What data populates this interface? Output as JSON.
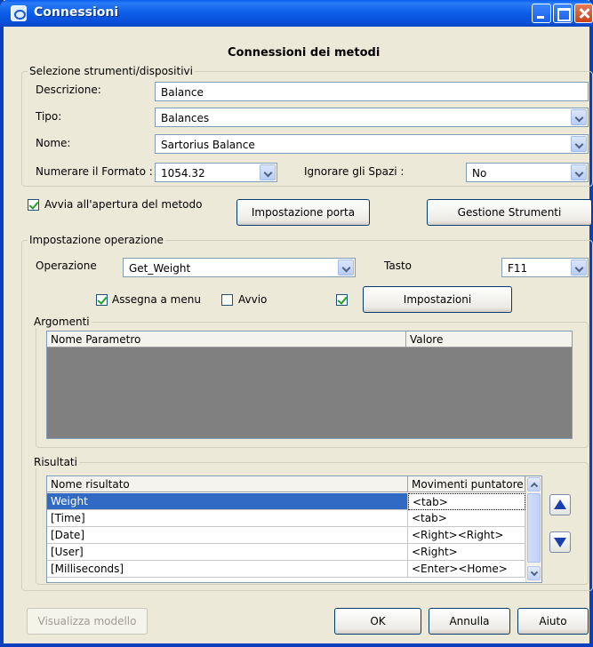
{
  "window": {
    "title": "Connessioni"
  },
  "header": {
    "title": "Connessioni dei metodi"
  },
  "devices": {
    "legend": "Selezione strumenti/dispositivi",
    "descrizione_label": "Descrizione:",
    "descrizione_value": "Balance",
    "tipo_label": "Tipo:",
    "tipo_value": "Balances",
    "nome_label": "Nome:",
    "nome_value": "Sartorius Balance",
    "formato_label": "Numerare il Formato :",
    "formato_value": "1054.32",
    "spazi_label": "Ignorare gli Spazi :",
    "spazi_value": "No"
  },
  "options": {
    "avvia_label": "Avvia all'apertura del metodo",
    "avvia_checked": true,
    "porta_button": "Impostazione porta",
    "strumenti_button": "Gestione Strumenti"
  },
  "operation": {
    "legend": "Impostazione operazione",
    "operazione_label": "Operazione",
    "operazione_value": "Get_Weight",
    "tasto_label": "Tasto",
    "tasto_value": "F11",
    "assegna_label": "Assegna a menu",
    "assegna_checked": true,
    "avvio_label": "Avvio",
    "avvio_checked": false,
    "extra_checked": true,
    "impostazioni_button": "Impostazioni"
  },
  "arguments": {
    "legend": "Argomenti",
    "columns": [
      "Nome Parametro",
      "Valore"
    ]
  },
  "results": {
    "legend": "Risultati",
    "columns": [
      "Nome risultato",
      "Movimenti puntatore"
    ],
    "rows": [
      {
        "name": "Weight",
        "move": "<tab>"
      },
      {
        "name": "[Time]",
        "move": "<tab>"
      },
      {
        "name": "[Date]",
        "move": "<Right><Right>"
      },
      {
        "name": "[User]",
        "move": "<Right>"
      },
      {
        "name": "[Milliseconds]",
        "move": "<Enter><Home>"
      }
    ],
    "selected_index": 0
  },
  "footer": {
    "visualizza_button": "Visualizza modello",
    "ok_button": "OK",
    "annulla_button": "Annulla",
    "aiuto_button": "Aiuto"
  }
}
